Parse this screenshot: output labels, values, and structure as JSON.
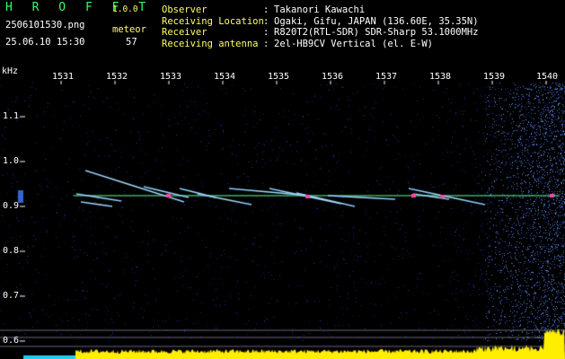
{
  "header": {
    "brand": "H R O F F T",
    "version": "1.0.0",
    "filename": "2506101530.png",
    "mode_label": "meteor",
    "timestamp": "25.06.10 15:30",
    "meteor_count": "57"
  },
  "station_info": [
    {
      "label": "Observer",
      "value": "Takanori Kawachi"
    },
    {
      "label": "Receiving Location",
      "value": "Ogaki, Gifu, JAPAN (136.60E, 35.35N)"
    },
    {
      "label": "Receiver",
      "value": "R820T2(RTL-SDR) SDR-Sharp 53.1000MHz"
    },
    {
      "label": "Receiving antenna",
      "value": "2el-HB9CV Vertical (el. E-W)"
    }
  ],
  "axes": {
    "unit_label": "kHz",
    "time_ticks": [
      "1531",
      "1532",
      "1533",
      "1534",
      "1535",
      "1536",
      "1537",
      "1538",
      "1539",
      "1540"
    ],
    "freq_ticks": [
      "1.1",
      "1.0",
      "0.9",
      "0.8",
      "0.7",
      "0.6"
    ]
  },
  "colors": {
    "background": "#000000",
    "noise": "#1a2a8c",
    "carrier": "#66ff99",
    "echo": "#88ccff",
    "echo_hot": "#ff44aa",
    "power_trace": "#ffee00",
    "header_green": "#33ff66",
    "header_yellow": "#ffff66"
  }
}
